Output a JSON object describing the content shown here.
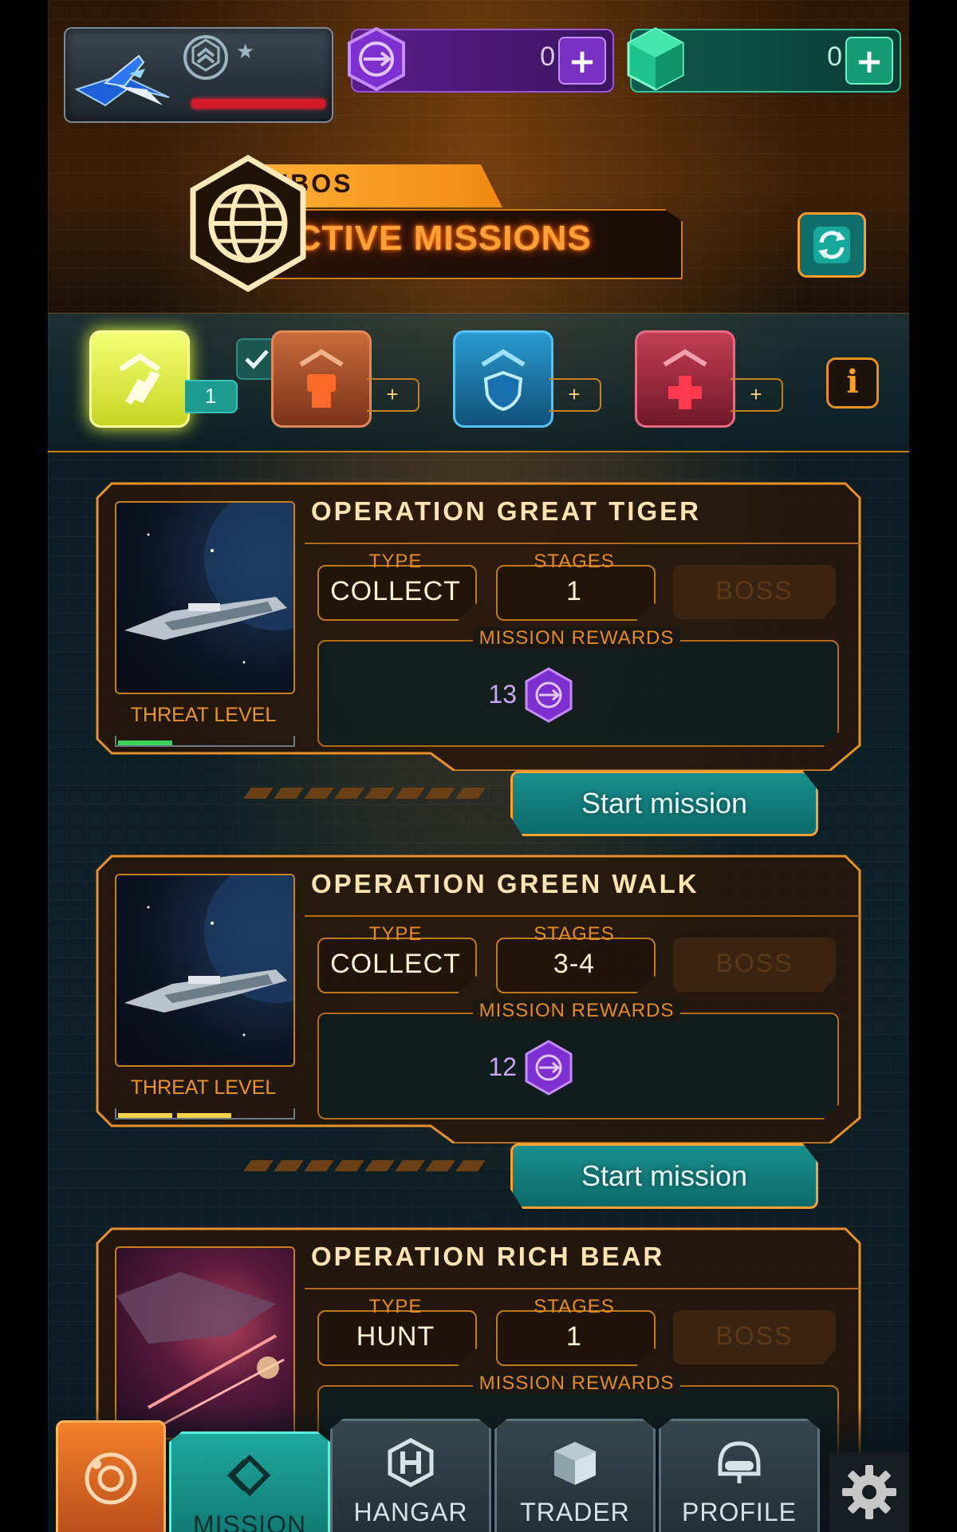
{
  "top_bar": {
    "premium_currency": {
      "amount": "0",
      "add_label": "+"
    },
    "gem_currency": {
      "amount": "0",
      "add_label": "+"
    }
  },
  "header": {
    "org": "UBOS",
    "title": "ACTIVE MISSIONS"
  },
  "categories": [
    {
      "name": "damage",
      "count": "1",
      "completed": true,
      "color": "#e4f04a"
    },
    {
      "name": "fist",
      "count": "+",
      "completed": false,
      "color": "#c4562a"
    },
    {
      "name": "shield",
      "count": "+",
      "completed": false,
      "color": "#1f8ebf"
    },
    {
      "name": "medic",
      "count": "+",
      "completed": false,
      "color": "#c0304a"
    }
  ],
  "info_label": "i",
  "missions": [
    {
      "title": "OPERATION GREAT TIGER",
      "type_label": "TYPE",
      "type": "COLLECT",
      "stages_label": "STAGES",
      "stages": "1",
      "boss_label": "BOSS",
      "rewards_label": "MISSION REWARDS",
      "reward": "13",
      "threat_label": "THREAT LEVEL",
      "threat_level": 1,
      "threat_color": "#3bd45a",
      "button": "Start mission"
    },
    {
      "title": "OPERATION GREEN WALK",
      "type_label": "TYPE",
      "type": "COLLECT",
      "stages_label": "STAGES",
      "stages": "3-4",
      "boss_label": "BOSS",
      "rewards_label": "MISSION REWARDS",
      "reward": "12",
      "threat_label": "THREAT LEVEL",
      "threat_level": 2,
      "threat_color": "#f0d24a",
      "button": "Start mission"
    },
    {
      "title": "OPERATION RICH BEAR",
      "type_label": "TYPE",
      "type": "HUNT",
      "stages_label": "STAGES",
      "stages": "1",
      "boss_label": "BOSS",
      "rewards_label": "MISSION REWARDS"
    }
  ],
  "nav": {
    "mission": "MISSION",
    "hangar": "HANGAR",
    "trader": "TRADER",
    "profile": "PROFILE"
  },
  "colors": {
    "accent": "#ff9b2a",
    "teal": "#1a8f8d",
    "purple": "#7a2fc3",
    "green": "#159a73"
  }
}
